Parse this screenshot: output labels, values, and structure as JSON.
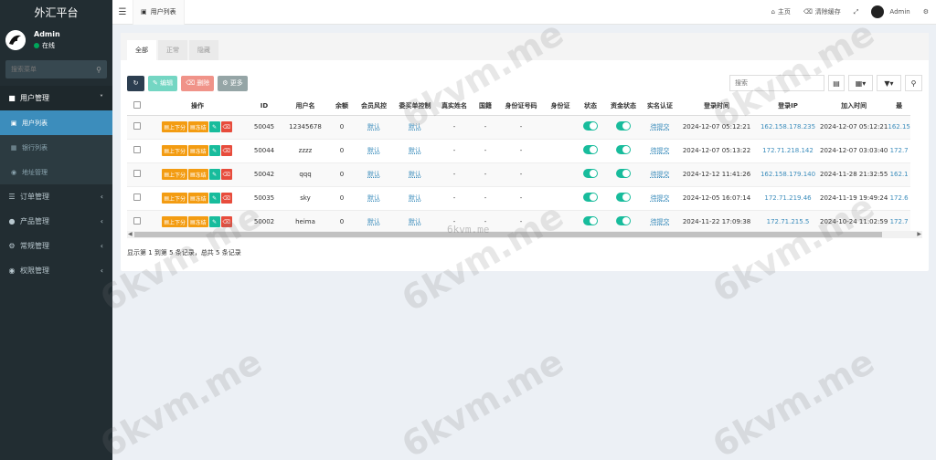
{
  "sidebar": {
    "brand": "外汇平台",
    "user_name": "Admin",
    "user_status": "在线",
    "search_placeholder": "搜索菜单",
    "menu": {
      "user_mgmt": "用户管理",
      "user_list": "用户列表",
      "bank_list": "银行列表",
      "address_mgmt": "地址管理",
      "order_mgmt": "订单管理",
      "product_mgmt": "产品管理",
      "general_mgmt": "常规管理",
      "perm_mgmt": "权限管理"
    }
  },
  "topbar": {
    "tab_label": "用户列表",
    "home": "主页",
    "clear_cache": "清除缓存",
    "admin": "Admin"
  },
  "tabs": [
    "全部",
    "正常",
    "隐藏"
  ],
  "toolbar": {
    "edit": "编辑",
    "delete": "删除",
    "more": "更多",
    "search_placeholder": "搜索"
  },
  "table": {
    "headers": [
      "操作",
      "ID",
      "用户名",
      "余额",
      "会员风控",
      "委买单控制",
      "真实姓名",
      "国籍",
      "身份证号码",
      "身份证",
      "状态",
      "资金状态",
      "实名认证",
      "登录时间",
      "登录IP",
      "加入时间",
      "最"
    ],
    "op_labels": {
      "updown": "上下分",
      "freeze": "冻结"
    },
    "rows": [
      {
        "id": "50045",
        "username": "12345678",
        "balance": "0",
        "risk": "默认",
        "order_ctrl": "默认",
        "real_name": "-",
        "nation": "-",
        "id_no": "-",
        "auth": "待提交",
        "login_time": "2024-12-07 05:12:21",
        "login_ip": "162.158.178.235",
        "join_time": "2024-12-07 05:12:21",
        "last": "162.15"
      },
      {
        "id": "50044",
        "username": "zzzz",
        "balance": "0",
        "risk": "默认",
        "order_ctrl": "默认",
        "real_name": "-",
        "nation": "-",
        "id_no": "-",
        "auth": "待提交",
        "login_time": "2024-12-07 05:13:22",
        "login_ip": "172.71.218.142",
        "join_time": "2024-12-07 03:03:40",
        "last": "172.7"
      },
      {
        "id": "50042",
        "username": "qqq",
        "balance": "0",
        "risk": "默认",
        "order_ctrl": "默认",
        "real_name": "-",
        "nation": "-",
        "id_no": "-",
        "auth": "待提交",
        "login_time": "2024-12-12 11:41:26",
        "login_ip": "162.158.179.140",
        "join_time": "2024-11-28 21:32:55",
        "last": "162.1"
      },
      {
        "id": "50035",
        "username": "sky",
        "balance": "0",
        "risk": "默认",
        "order_ctrl": "默认",
        "real_name": "-",
        "nation": "-",
        "id_no": "-",
        "auth": "待提交",
        "login_time": "2024-12-05 16:07:14",
        "login_ip": "172.71.219.46",
        "join_time": "2024-11-19 19:49:24",
        "last": "172.6"
      },
      {
        "id": "50002",
        "username": "heima",
        "balance": "0",
        "risk": "默认",
        "order_ctrl": "默认",
        "real_name": "-",
        "nation": "-",
        "id_no": "-",
        "auth": "待提交",
        "login_time": "2024-11-22 17:09:38",
        "login_ip": "172.71.215.5",
        "join_time": "2024-10-24 11:02:59",
        "last": "172.7"
      }
    ]
  },
  "pager_text": "显示第 1 到第 5 条记录，总共 5 条记录",
  "watermark": "6kvm.me"
}
